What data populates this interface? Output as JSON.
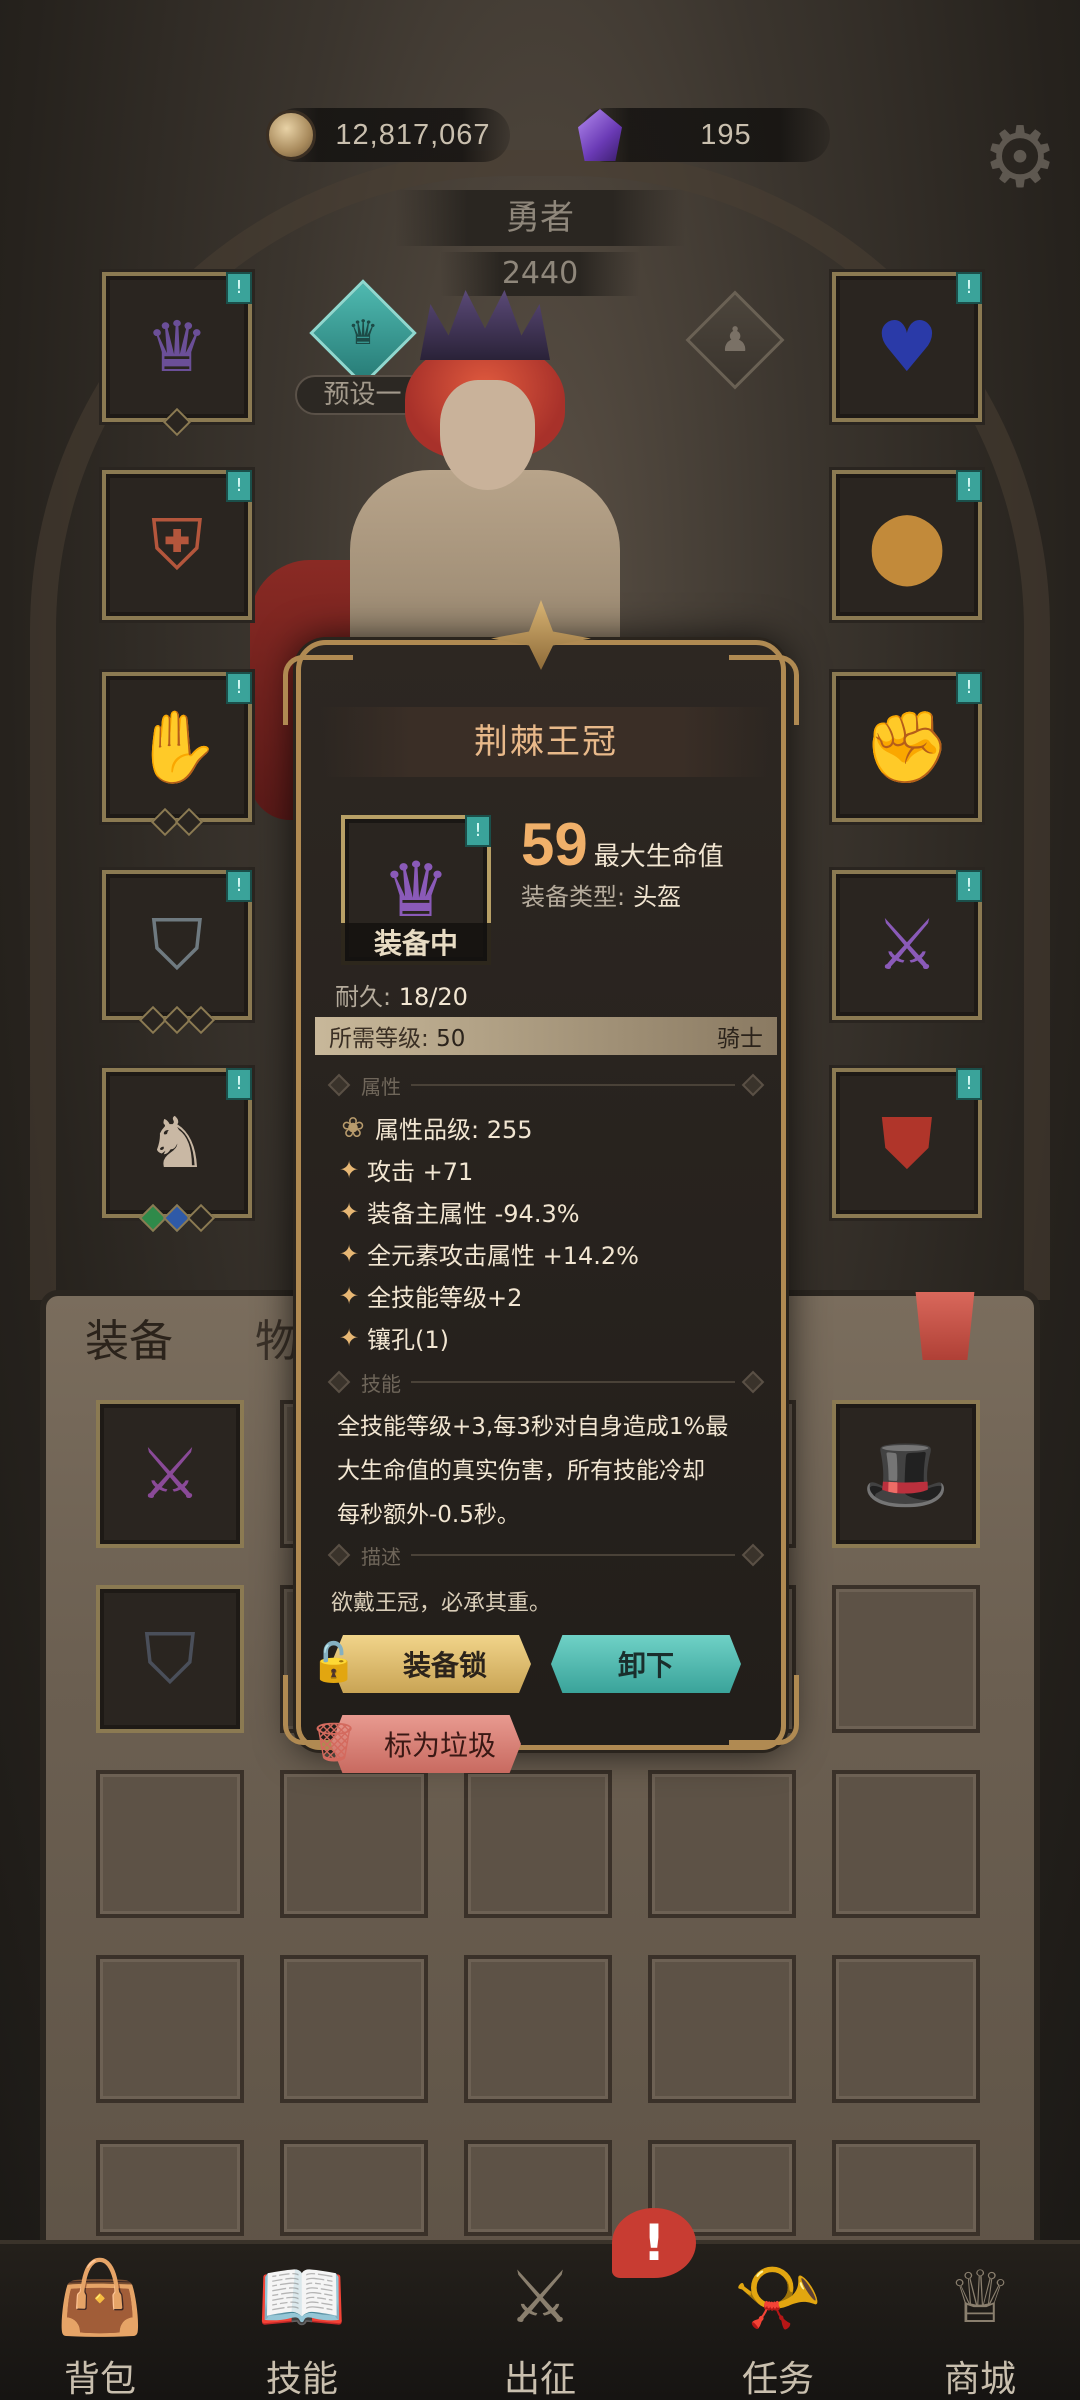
{
  "currency": {
    "gold": "12,817,067",
    "gems": "195"
  },
  "hero": {
    "title": "勇者",
    "power": "2440",
    "preset_label": "预设一"
  },
  "equip_slots": {
    "left": [
      {
        "name": "crown",
        "icon": "👑"
      },
      {
        "name": "chest-armor",
        "icon": "🦺"
      },
      {
        "name": "gauntlet",
        "icon": "🦾"
      },
      {
        "name": "leg-armor",
        "icon": "🛡"
      },
      {
        "name": "boots",
        "icon": "👢"
      }
    ],
    "right": [
      {
        "name": "heart-amulet",
        "icon": "💙"
      },
      {
        "name": "pauldron",
        "icon": "🥔"
      },
      {
        "name": "fist-gauntlet",
        "icon": "✊"
      },
      {
        "name": "dagger",
        "icon": "🗡"
      },
      {
        "name": "shield",
        "icon": "🛡"
      }
    ]
  },
  "inventory": {
    "tabs": [
      "装备",
      "物品"
    ],
    "items": [
      {
        "name": "purple-dagger",
        "icon": "🗡"
      },
      {
        "name": "dark-hat",
        "icon": "🎩"
      },
      {
        "name": "iron-greaves",
        "icon": "👖"
      }
    ]
  },
  "nav": [
    {
      "label": "背包",
      "icon": "bag-icon"
    },
    {
      "label": "技能",
      "icon": "skill-book-icon"
    },
    {
      "label": "出征",
      "icon": "sword-map-icon"
    },
    {
      "label": "任务",
      "icon": "horn-icon"
    },
    {
      "label": "商城",
      "icon": "shop-crown-icon"
    }
  ],
  "alert_badge": "!",
  "popup": {
    "title": "荆棘王冠",
    "equipped_label": "装备中",
    "main_stat_value": "59",
    "main_stat_name": "最大生命值",
    "type_key": "装备类型:",
    "type_value": "头盔",
    "durability_key": "耐久:",
    "durability_value": "18/20",
    "req_level_key": "所需等级:",
    "req_level_value": "50",
    "req_class": "骑士",
    "section_attributes": "属性",
    "section_skill": "技能",
    "section_desc": "描述",
    "attr_quality": "属性品级: 255",
    "attributes": [
      "攻击 +71",
      "装备主属性 -94.3%",
      "全元素攻击属性 +14.2%",
      "全技能等级+2",
      "镶孔(1)"
    ],
    "skill_lines": [
      "全技能等级+3,每3秒对自身造成1%最",
      "大生命值的真实伤害，所有技能冷却",
      "每秒额外-0.5秒。"
    ],
    "description": "欲戴王冠，必承其重。",
    "btn_lock": "装备锁",
    "btn_unequip": "卸下",
    "btn_junk": "标为垃圾"
  }
}
